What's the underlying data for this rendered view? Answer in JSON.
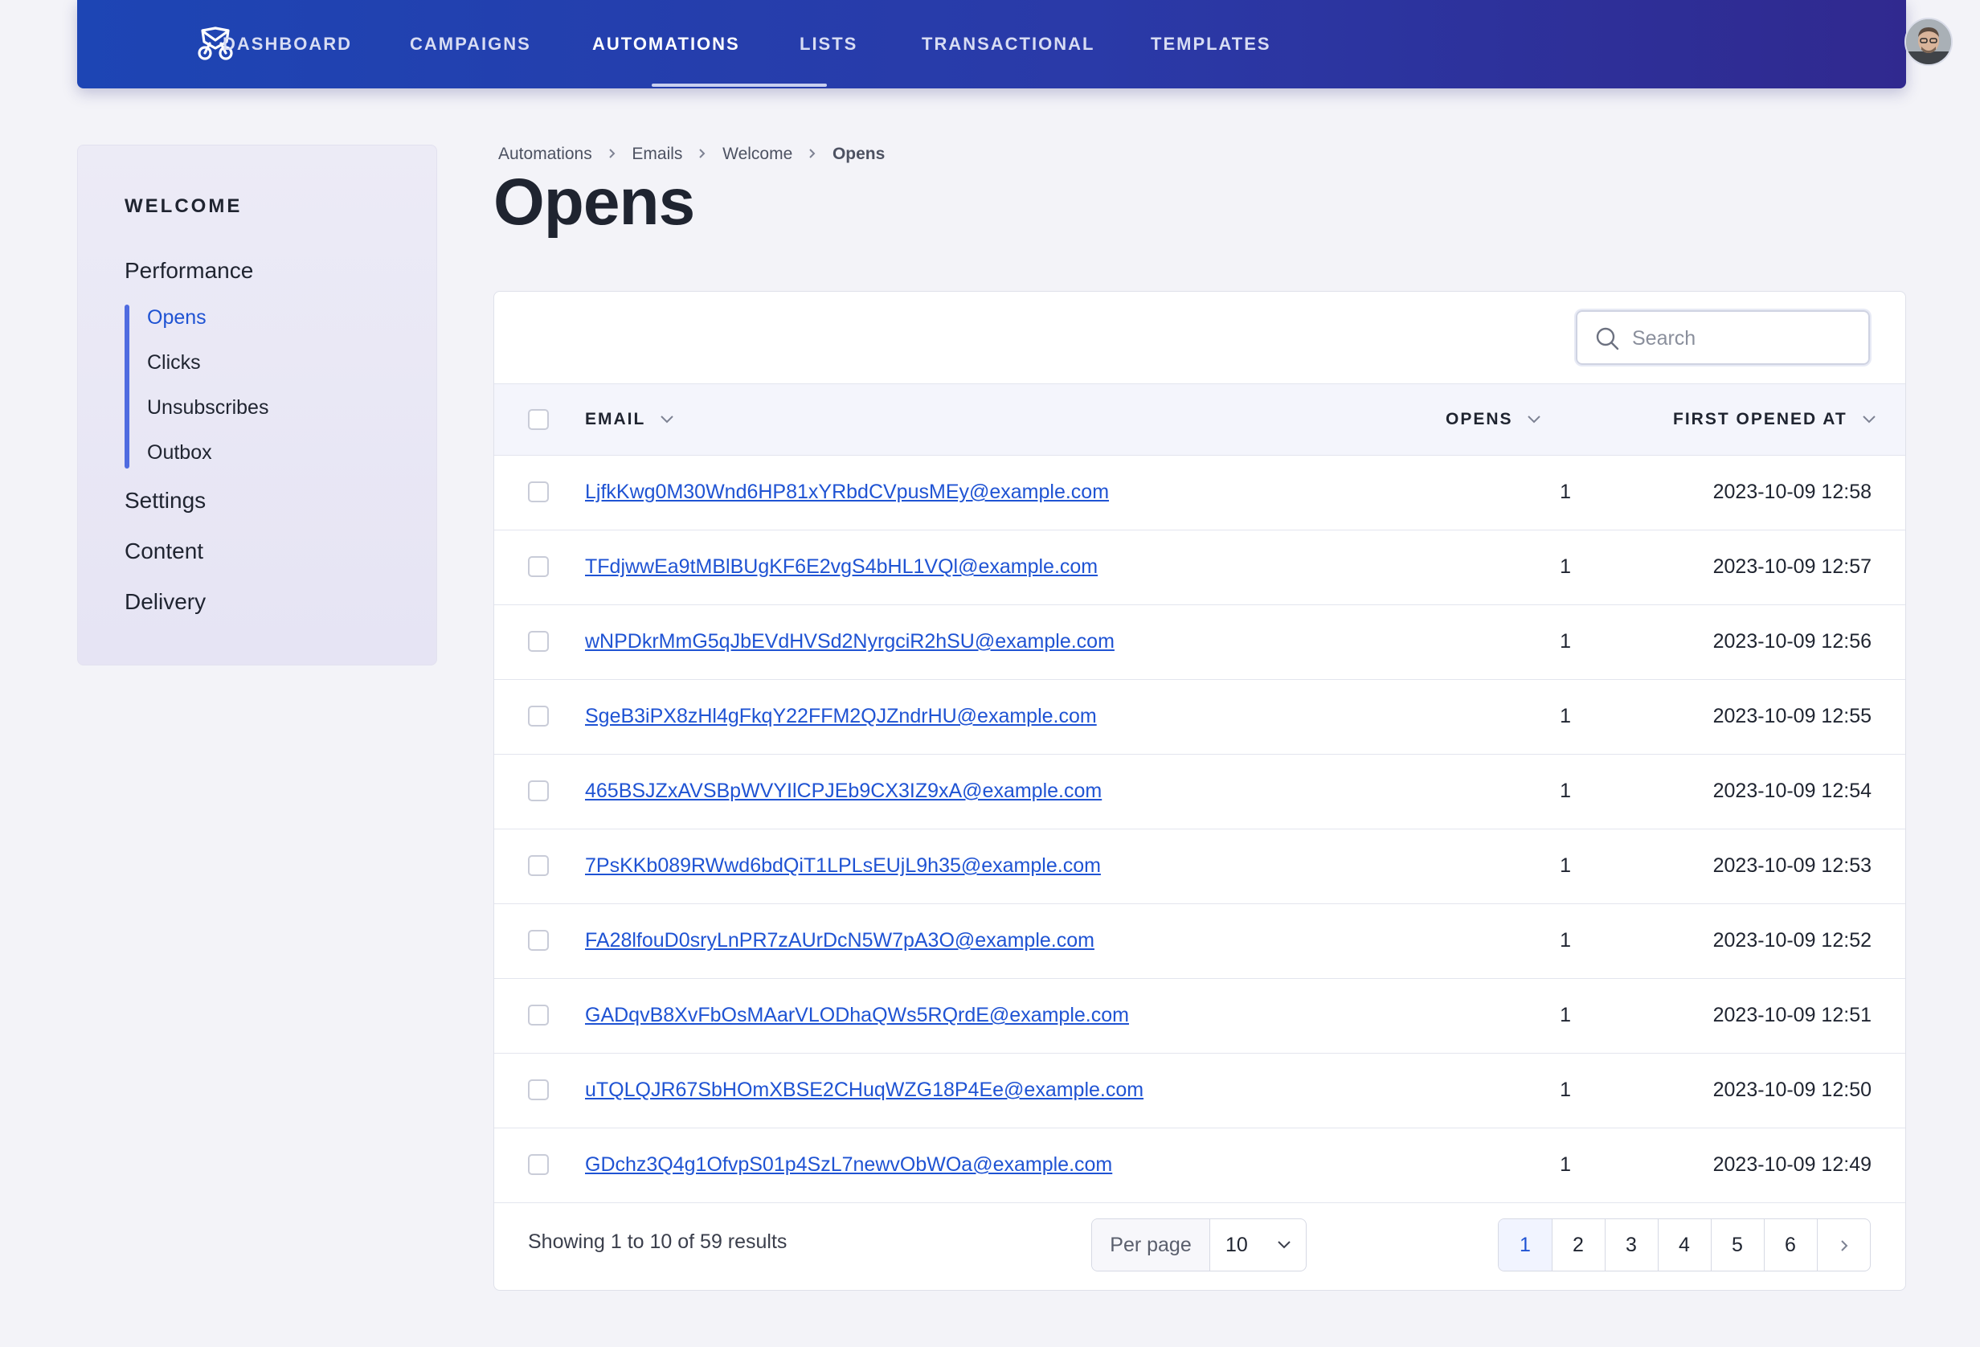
{
  "nav": {
    "items": [
      {
        "label": "DASHBOARD"
      },
      {
        "label": "CAMPAIGNS"
      },
      {
        "label": "AUTOMATIONS"
      },
      {
        "label": "LISTS"
      },
      {
        "label": "TRANSACTIONAL"
      },
      {
        "label": "TEMPLATES"
      }
    ],
    "active_index": 2,
    "logo_icon": "mail-bicycle-logo-icon",
    "avatar_icon": "user-avatar"
  },
  "sidebar": {
    "title": "WELCOME",
    "groups": [
      {
        "label": "Performance"
      },
      {
        "label": "Settings"
      },
      {
        "label": "Content"
      },
      {
        "label": "Delivery"
      }
    ],
    "performance_items": [
      {
        "label": "Opens"
      },
      {
        "label": "Clicks"
      },
      {
        "label": "Unsubscribes"
      },
      {
        "label": "Outbox"
      }
    ],
    "active_item": "Opens"
  },
  "breadcrumb": [
    "Automations",
    "Emails",
    "Welcome",
    "Opens"
  ],
  "page_title": "Opens",
  "search": {
    "placeholder": "Search",
    "value": ""
  },
  "table": {
    "columns": {
      "email": "EMAIL",
      "opens": "OPENS",
      "first_opened": "FIRST OPENED AT"
    },
    "rows": [
      {
        "email": "LjfkKwg0M30Wnd6HP81xYRbdCVpusMEy@example.com",
        "opens": "1",
        "first_opened": "2023-10-09 12:58"
      },
      {
        "email": "TFdjwwEa9tMBlBUgKF6E2vgS4bHL1VQl@example.com",
        "opens": "1",
        "first_opened": "2023-10-09 12:57"
      },
      {
        "email": "wNPDkrMmG5qJbEVdHVSd2NyrgciR2hSU@example.com",
        "opens": "1",
        "first_opened": "2023-10-09 12:56"
      },
      {
        "email": "SgeB3iPX8zHl4gFkqY22FFM2QJZndrHU@example.com",
        "opens": "1",
        "first_opened": "2023-10-09 12:55"
      },
      {
        "email": "465BSJZxAVSBpWVYIlCPJEb9CX3IZ9xA@example.com",
        "opens": "1",
        "first_opened": "2023-10-09 12:54"
      },
      {
        "email": "7PsKKb089RWwd6bdQiT1LPLsEUjL9h35@example.com",
        "opens": "1",
        "first_opened": "2023-10-09 12:53"
      },
      {
        "email": "FA28lfouD0sryLnPR7zAUrDcN5W7pA3O@example.com",
        "opens": "1",
        "first_opened": "2023-10-09 12:52"
      },
      {
        "email": "GADqvB8XvFbOsMAarVLODhaQWs5RQrdE@example.com",
        "opens": "1",
        "first_opened": "2023-10-09 12:51"
      },
      {
        "email": "uTQLQJR67SbHOmXBSE2CHuqWZG18P4Ee@example.com",
        "opens": "1",
        "first_opened": "2023-10-09 12:50"
      },
      {
        "email": "GDchz3Q4g1OfvpS01p4SzL7newvObWOa@example.com",
        "opens": "1",
        "first_opened": "2023-10-09 12:49"
      }
    ]
  },
  "footer": {
    "results_text": "Showing 1 to 10 of 59 results",
    "per_page_label": "Per page",
    "per_page_value": "10",
    "pages": [
      "1",
      "2",
      "3",
      "4",
      "5",
      "6"
    ],
    "current_page": "1"
  },
  "colors": {
    "nav_gradient_start": "#1d45b4",
    "nav_gradient_end": "#30298f",
    "link": "#1f53d3",
    "sidebar_accent": "#4f6be0"
  }
}
